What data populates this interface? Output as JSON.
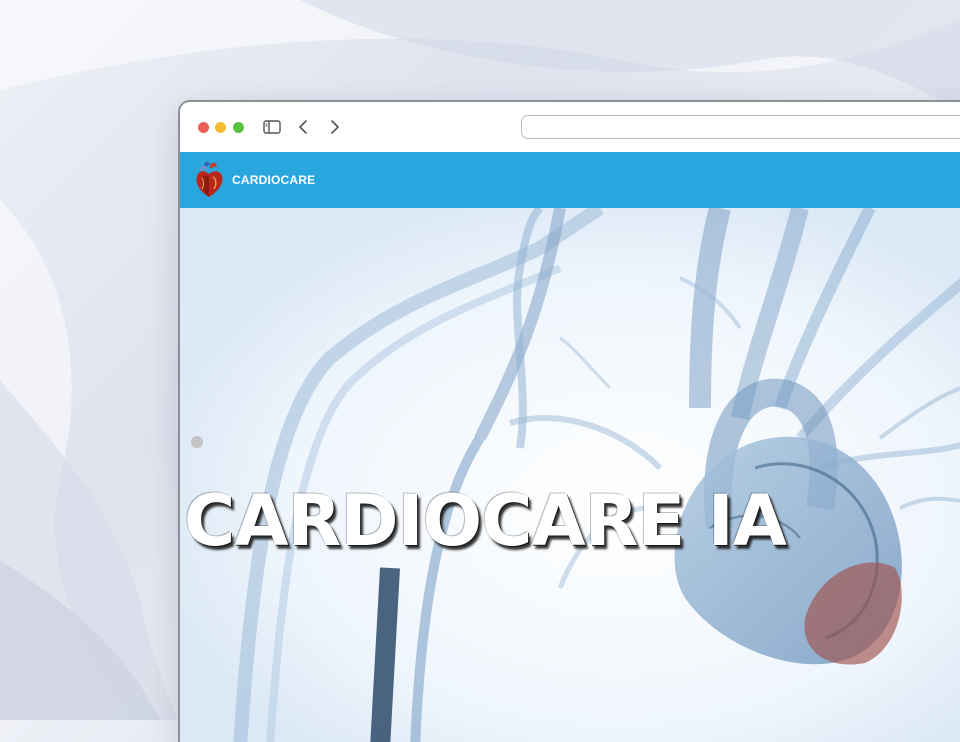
{
  "browser": {
    "address_value": "",
    "controls": {
      "close_color": "#ec5f57",
      "minimize_color": "#f3bc32",
      "maximize_color": "#58c041",
      "sidebar_icon": "sidebar-icon",
      "back_icon": "chevron-left-icon",
      "forward_icon": "chevron-right-icon"
    }
  },
  "navbar": {
    "brand": "CARDIOCARE",
    "logo_icon": "heart-icon",
    "background_color": "#2aa6de"
  },
  "hero": {
    "title": "CARDIOCARE IA",
    "image": "x-ray-heart-illustration",
    "carousel_indicator": "carousel-dot"
  }
}
